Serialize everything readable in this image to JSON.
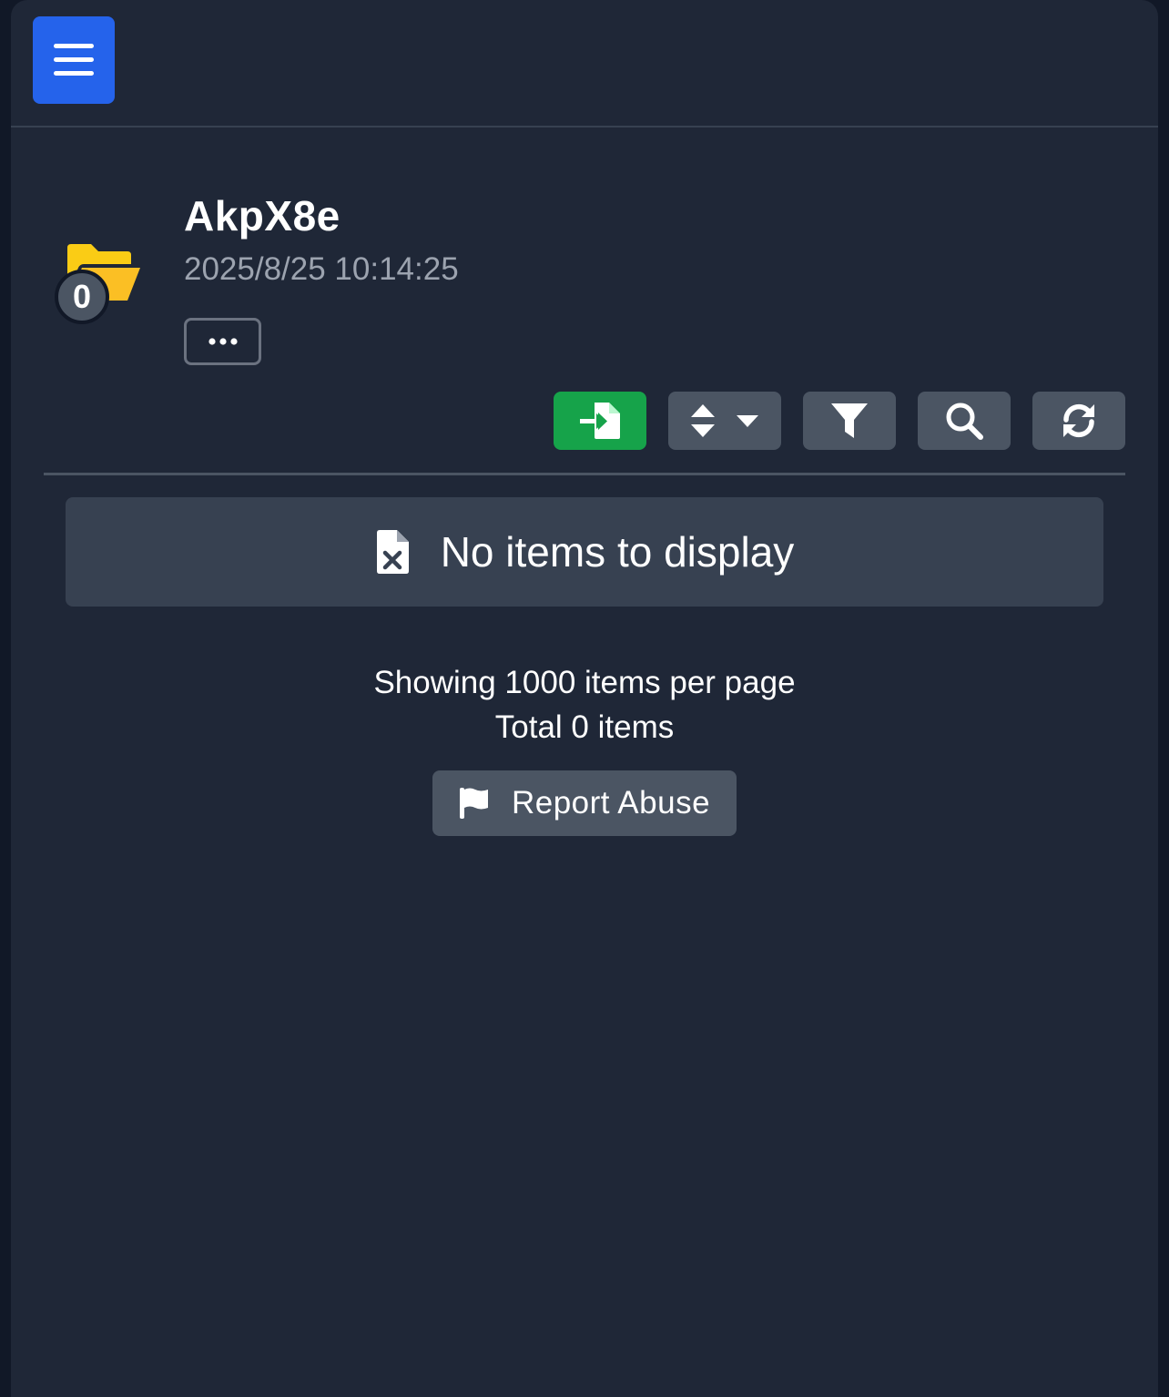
{
  "header": {
    "menu_icon": "hamburger-menu-icon"
  },
  "folder": {
    "icon": "open-folder-icon",
    "count": "0",
    "title": "AkpX8e",
    "datetime": "2025/8/25 10:14:25",
    "more_icon": "ellipsis-icon"
  },
  "toolbar": {
    "buttons": [
      {
        "icon": "file-import-icon",
        "color": "#16a34a"
      },
      {
        "icon": "sort-icon",
        "color": "#4b5563"
      },
      {
        "icon": "filter-icon",
        "color": "#4b5563"
      },
      {
        "icon": "search-icon",
        "color": "#4b5563"
      },
      {
        "icon": "refresh-icon",
        "color": "#4b5563"
      }
    ]
  },
  "empty_state": {
    "icon": "file-excel-icon",
    "text": "No items to display"
  },
  "pagination": {
    "per_page_text": "Showing 1000 items per page",
    "total_text": "Total 0 items"
  },
  "report": {
    "icon": "flag-icon",
    "label": "Report Abuse"
  },
  "colors": {
    "accent": "#2563eb",
    "success": "#16a34a",
    "folder": "#facc15",
    "background": "#1f2737"
  }
}
